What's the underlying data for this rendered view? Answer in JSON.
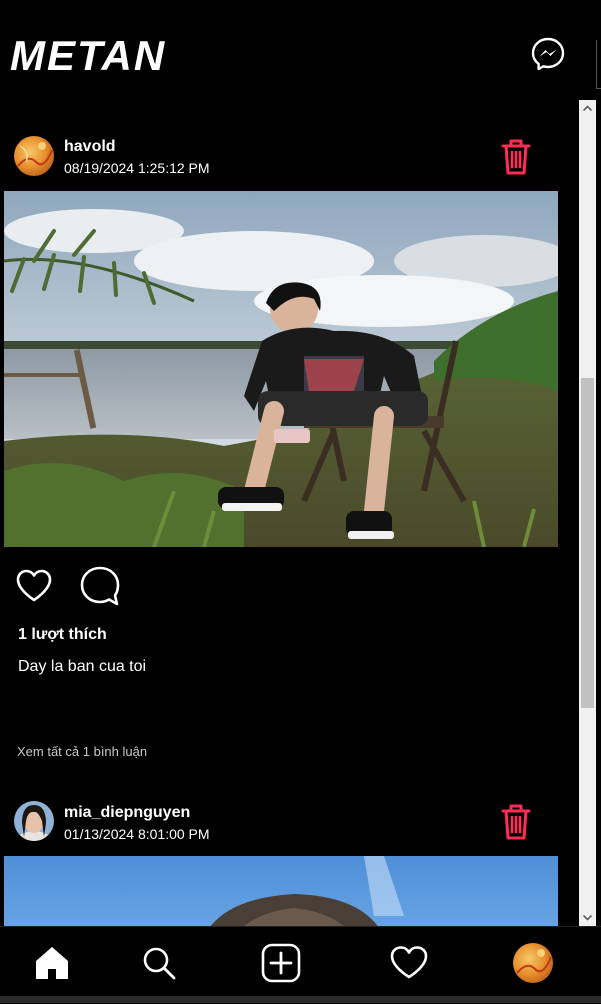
{
  "app": {
    "logo_text": "METAN"
  },
  "colors": {
    "background": "#000000",
    "text": "#ffffff",
    "delete_accent": "#ff2d55",
    "muted_text": "#c8c8c8"
  },
  "header": {
    "messenger_icon": "messenger-icon"
  },
  "posts": [
    {
      "username": "havold",
      "timestamp": "08/19/2024 1:25:12 PM",
      "likes": "1 lượt thích",
      "caption": "Day la ban cua toi",
      "view_comments": "Xem tất cả 1 bình luận",
      "delete_icon": "trash-icon"
    },
    {
      "username": "mia_diepnguyen",
      "timestamp": "01/13/2024 8:01:00 PM",
      "delete_icon": "trash-icon"
    }
  ],
  "bottom_nav": {
    "items": [
      "home-icon",
      "search-icon",
      "create-post-icon",
      "heart-icon",
      "profile-avatar"
    ]
  }
}
